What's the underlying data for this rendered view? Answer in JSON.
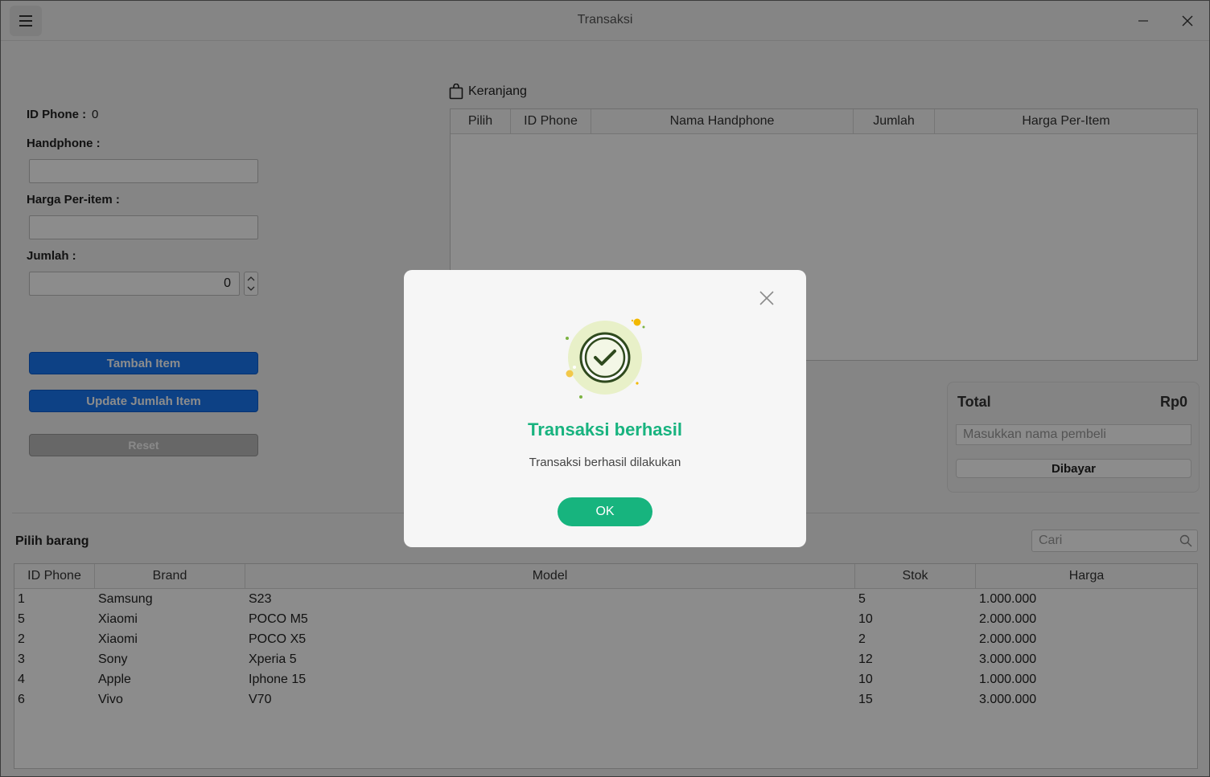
{
  "window": {
    "title": "Transaksi"
  },
  "form": {
    "id_label": "ID Phone :",
    "id_value": "0",
    "handphone_label": "Handphone :",
    "handphone_value": "",
    "price_label": "Harga Per-item :",
    "price_value": "",
    "qty_label": "Jumlah :",
    "qty_value": "0",
    "add_button": "Tambah Item",
    "update_button": "Update Jumlah Item",
    "reset_button": "Reset"
  },
  "cart": {
    "title": "Keranjang",
    "columns": [
      "Pilih",
      "ID Phone",
      "Nama Handphone",
      "Jumlah",
      "Harga Per-Item"
    ],
    "rows": []
  },
  "total": {
    "label": "Total",
    "value": "Rp0",
    "buyer_placeholder": "Masukkan nama pembeli",
    "pay_button": "Dibayar"
  },
  "items": {
    "title": "Pilih barang",
    "search_placeholder": "Cari",
    "columns": [
      "ID Phone",
      "Brand",
      "Model",
      "Stok",
      "Harga"
    ],
    "rows": [
      [
        "1",
        "Samsung",
        "S23",
        "5",
        "1.000.000"
      ],
      [
        "5",
        "Xiaomi",
        "POCO M5",
        "10",
        "2.000.000"
      ],
      [
        "2",
        "Xiaomi",
        "POCO X5",
        "2",
        "2.000.000"
      ],
      [
        "3",
        "Sony",
        "Xperia 5",
        "12",
        "3.000.000"
      ],
      [
        "4",
        "Apple",
        "Iphone 15",
        "10",
        "1.000.000"
      ],
      [
        "6",
        "Vivo",
        "V70",
        "15",
        "3.000.000"
      ]
    ]
  },
  "dialog": {
    "title": "Transaksi berhasil",
    "message": "Transaksi berhasil dilakukan",
    "ok_button": "OK",
    "icon": "success-check-icon",
    "accent_color": "#18b37f"
  }
}
